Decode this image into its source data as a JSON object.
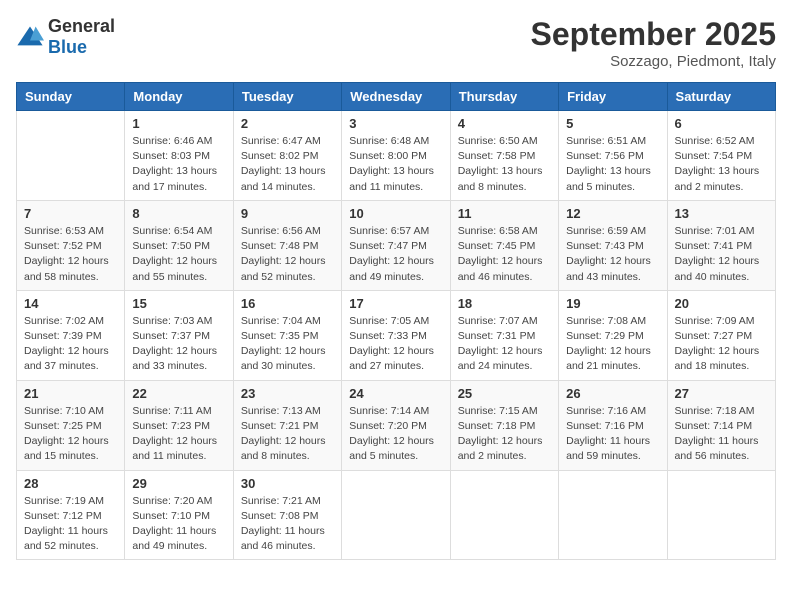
{
  "header": {
    "logo": {
      "general": "General",
      "blue": "Blue"
    },
    "month": "September 2025",
    "location": "Sozzago, Piedmont, Italy"
  },
  "days_of_week": [
    "Sunday",
    "Monday",
    "Tuesday",
    "Wednesday",
    "Thursday",
    "Friday",
    "Saturday"
  ],
  "weeks": [
    [
      null,
      {
        "day": 1,
        "sunrise": "6:46 AM",
        "sunset": "8:03 PM",
        "daylight": "13 hours and 17 minutes."
      },
      {
        "day": 2,
        "sunrise": "6:47 AM",
        "sunset": "8:02 PM",
        "daylight": "13 hours and 14 minutes."
      },
      {
        "day": 3,
        "sunrise": "6:48 AM",
        "sunset": "8:00 PM",
        "daylight": "13 hours and 11 minutes."
      },
      {
        "day": 4,
        "sunrise": "6:50 AM",
        "sunset": "7:58 PM",
        "daylight": "13 hours and 8 minutes."
      },
      {
        "day": 5,
        "sunrise": "6:51 AM",
        "sunset": "7:56 PM",
        "daylight": "13 hours and 5 minutes."
      },
      {
        "day": 6,
        "sunrise": "6:52 AM",
        "sunset": "7:54 PM",
        "daylight": "13 hours and 2 minutes."
      }
    ],
    [
      {
        "day": 7,
        "sunrise": "6:53 AM",
        "sunset": "7:52 PM",
        "daylight": "12 hours and 58 minutes."
      },
      {
        "day": 8,
        "sunrise": "6:54 AM",
        "sunset": "7:50 PM",
        "daylight": "12 hours and 55 minutes."
      },
      {
        "day": 9,
        "sunrise": "6:56 AM",
        "sunset": "7:48 PM",
        "daylight": "12 hours and 52 minutes."
      },
      {
        "day": 10,
        "sunrise": "6:57 AM",
        "sunset": "7:47 PM",
        "daylight": "12 hours and 49 minutes."
      },
      {
        "day": 11,
        "sunrise": "6:58 AM",
        "sunset": "7:45 PM",
        "daylight": "12 hours and 46 minutes."
      },
      {
        "day": 12,
        "sunrise": "6:59 AM",
        "sunset": "7:43 PM",
        "daylight": "12 hours and 43 minutes."
      },
      {
        "day": 13,
        "sunrise": "7:01 AM",
        "sunset": "7:41 PM",
        "daylight": "12 hours and 40 minutes."
      }
    ],
    [
      {
        "day": 14,
        "sunrise": "7:02 AM",
        "sunset": "7:39 PM",
        "daylight": "12 hours and 37 minutes."
      },
      {
        "day": 15,
        "sunrise": "7:03 AM",
        "sunset": "7:37 PM",
        "daylight": "12 hours and 33 minutes."
      },
      {
        "day": 16,
        "sunrise": "7:04 AM",
        "sunset": "7:35 PM",
        "daylight": "12 hours and 30 minutes."
      },
      {
        "day": 17,
        "sunrise": "7:05 AM",
        "sunset": "7:33 PM",
        "daylight": "12 hours and 27 minutes."
      },
      {
        "day": 18,
        "sunrise": "7:07 AM",
        "sunset": "7:31 PM",
        "daylight": "12 hours and 24 minutes."
      },
      {
        "day": 19,
        "sunrise": "7:08 AM",
        "sunset": "7:29 PM",
        "daylight": "12 hours and 21 minutes."
      },
      {
        "day": 20,
        "sunrise": "7:09 AM",
        "sunset": "7:27 PM",
        "daylight": "12 hours and 18 minutes."
      }
    ],
    [
      {
        "day": 21,
        "sunrise": "7:10 AM",
        "sunset": "7:25 PM",
        "daylight": "12 hours and 15 minutes."
      },
      {
        "day": 22,
        "sunrise": "7:11 AM",
        "sunset": "7:23 PM",
        "daylight": "12 hours and 11 minutes."
      },
      {
        "day": 23,
        "sunrise": "7:13 AM",
        "sunset": "7:21 PM",
        "daylight": "12 hours and 8 minutes."
      },
      {
        "day": 24,
        "sunrise": "7:14 AM",
        "sunset": "7:20 PM",
        "daylight": "12 hours and 5 minutes."
      },
      {
        "day": 25,
        "sunrise": "7:15 AM",
        "sunset": "7:18 PM",
        "daylight": "12 hours and 2 minutes."
      },
      {
        "day": 26,
        "sunrise": "7:16 AM",
        "sunset": "7:16 PM",
        "daylight": "11 hours and 59 minutes."
      },
      {
        "day": 27,
        "sunrise": "7:18 AM",
        "sunset": "7:14 PM",
        "daylight": "11 hours and 56 minutes."
      }
    ],
    [
      {
        "day": 28,
        "sunrise": "7:19 AM",
        "sunset": "7:12 PM",
        "daylight": "11 hours and 52 minutes."
      },
      {
        "day": 29,
        "sunrise": "7:20 AM",
        "sunset": "7:10 PM",
        "daylight": "11 hours and 49 minutes."
      },
      {
        "day": 30,
        "sunrise": "7:21 AM",
        "sunset": "7:08 PM",
        "daylight": "11 hours and 46 minutes."
      },
      null,
      null,
      null,
      null
    ]
  ]
}
